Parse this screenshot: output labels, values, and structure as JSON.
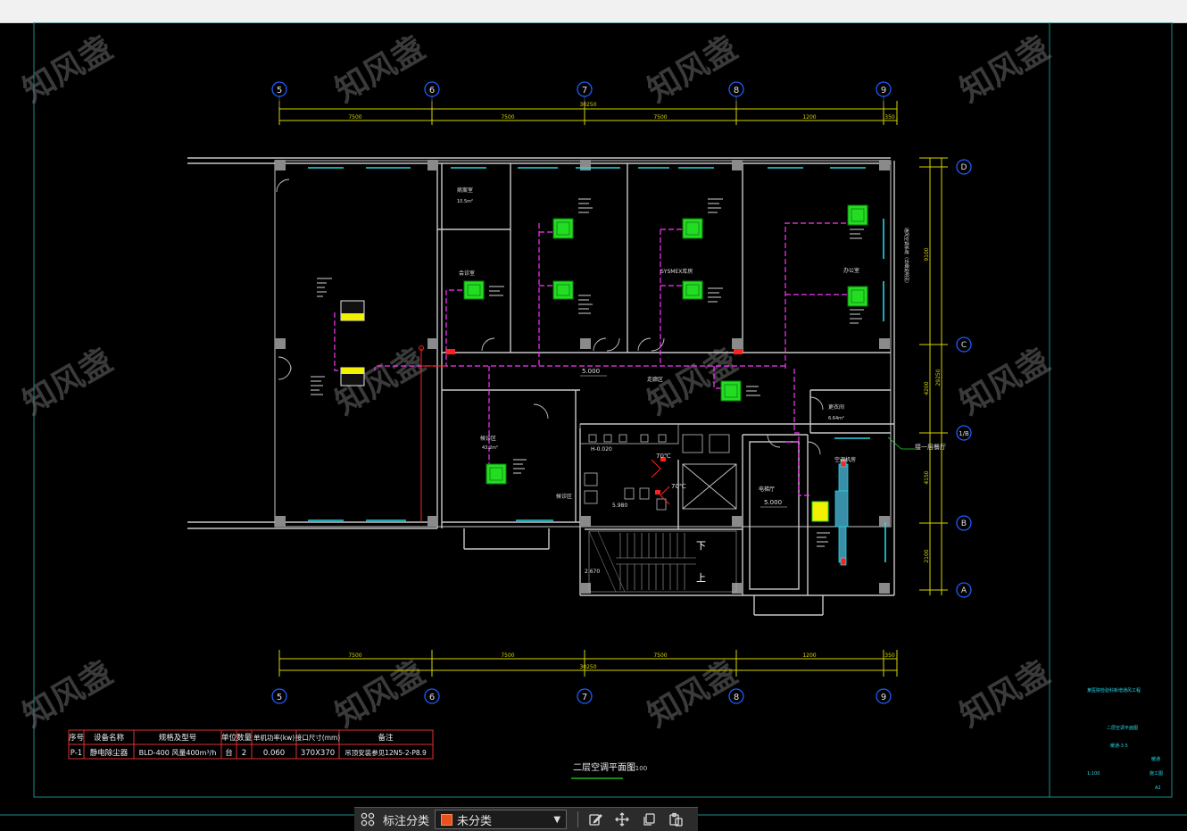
{
  "grid": {
    "vertical_labels": [
      "5",
      "6",
      "7",
      "8",
      "9"
    ],
    "horizontal_labels": [
      "D",
      "C",
      "1/B",
      "B",
      "A"
    ],
    "top_spans": [
      "7500",
      "7500",
      "7500",
      "1200",
      "350"
    ],
    "top_total": "30250",
    "bottom_spans": [
      "7500",
      "7500",
      "7500",
      "1200",
      "350"
    ],
    "bottom_total": "30250",
    "right_spans": [
      "9100",
      "4200",
      "4150",
      "2100"
    ],
    "right_total": "29250"
  },
  "rooms": {
    "room1": "病案室",
    "room2": "会诊室",
    "sysmex": "SYSMEX库房",
    "room4": "办公室",
    "corridor": "走廊区",
    "room5": "更衣间",
    "room6": "候诊区",
    "elevator": "电梯厅",
    "stair_down": "下",
    "stair_up": "上",
    "stair_level": "2.670",
    "level_main": "5.000",
    "level_elev": "5.000",
    "level_wc": "5.980",
    "level_h": "H-0.020",
    "room_ac": "空调机房",
    "callout": "接一层餐厅",
    "area1": "10.5m²",
    "area2": "6.64m²",
    "area3": "43.2m²",
    "right_label": "通风空调系统（详细说明见）",
    "temp1": "70℃",
    "temp2": "70℃"
  },
  "table": {
    "headers": [
      "序号",
      "设备名称",
      "规格及型号",
      "单位",
      "数量",
      "单机功率(kw)",
      "接口尺寸(mm)",
      "备注"
    ],
    "rows": [
      [
        "P-1",
        "静电除尘器",
        "BLD-400 风量400m³/h",
        "台",
        "2",
        "0.060",
        "370X370",
        "吊顶安装参见12N5-2-P8.9"
      ]
    ]
  },
  "drawing_title": "二层空调平面图",
  "drawing_scale": "1:100",
  "title_block": {
    "line1": "某医院检验科新增通风工程",
    "line2": "二层空调平面图",
    "line3": "暖通-3.5",
    "line4": "暖通",
    "line5": "1:100",
    "line6": "施工图",
    "line7": "A2"
  },
  "watermark": "知风盏",
  "toolbar": {
    "label": "标注分类",
    "selected": "未分类",
    "swatch_color": "#e8521c"
  },
  "colors": {
    "background": "#000000",
    "axis": "#1f5cff",
    "wall": "#c8c8c8",
    "ductwork": "#ff33ff",
    "equipment": "#22dd22",
    "dimension": "#d4d400",
    "fire": "#ff2020",
    "window": "#25d6e5"
  }
}
